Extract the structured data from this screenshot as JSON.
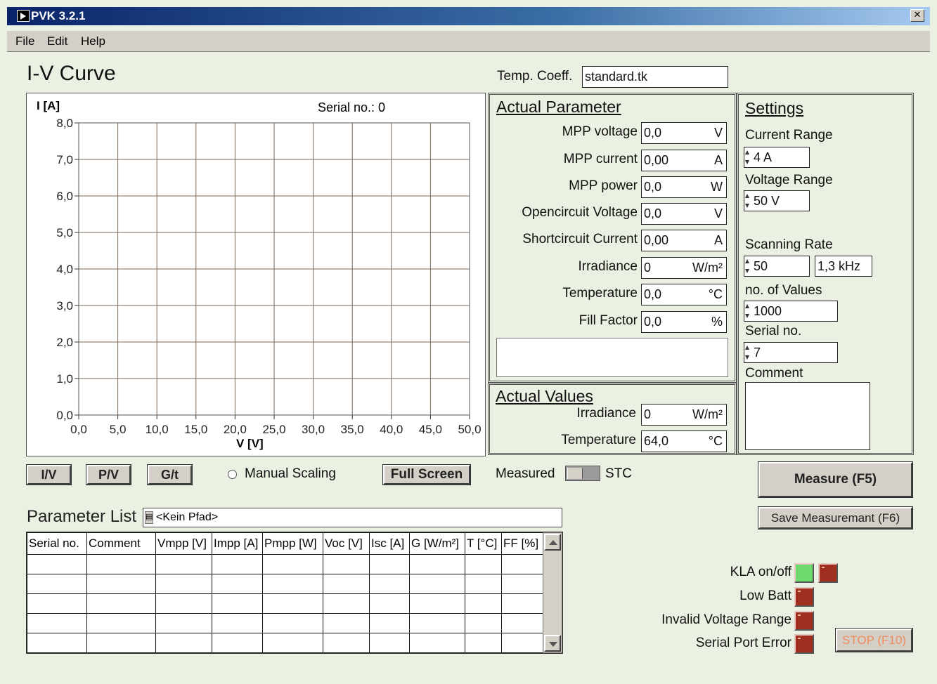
{
  "window": {
    "title": "PVK 3.2.1",
    "close": "✕"
  },
  "menu": [
    "File",
    "Edit",
    "Help"
  ],
  "page_title": "I-V Curve",
  "temp_coeff": {
    "label": "Temp. Coeff.",
    "value": "standard.tk"
  },
  "chart_data": {
    "type": "line",
    "title": "",
    "xlabel": "V [V]",
    "ylabel": "I [A]",
    "annotation": "Serial no.: 0",
    "x_ticks": [
      "0,0",
      "5,0",
      "10,0",
      "15,0",
      "20,0",
      "25,0",
      "30,0",
      "35,0",
      "40,0",
      "45,0",
      "50,0"
    ],
    "y_ticks": [
      "8,0",
      "7,0",
      "6,0",
      "5,0",
      "4,0",
      "3,0",
      "2,0",
      "1,0",
      "0,0"
    ],
    "xlim": [
      0,
      50
    ],
    "ylim": [
      0,
      8
    ],
    "grid": true,
    "series": []
  },
  "actual_parameter": {
    "title": "Actual Parameter",
    "rows": [
      {
        "label": "MPP voltage",
        "value": "0,0",
        "unit": "V"
      },
      {
        "label": "MPP current",
        "value": "0,00",
        "unit": "A"
      },
      {
        "label": "MPP power",
        "value": "0,0",
        "unit": "W"
      },
      {
        "label": "Opencircuit Voltage",
        "value": "0,0",
        "unit": "V"
      },
      {
        "label": "Shortcircuit Current",
        "value": "0,00",
        "unit": "A"
      },
      {
        "label": "Irradiance",
        "value": "0",
        "unit": "W/m²"
      },
      {
        "label": "Temperature",
        "value": "0,0",
        "unit": "°C"
      },
      {
        "label": "Fill Factor",
        "value": "0,0",
        "unit": "%"
      }
    ]
  },
  "actual_values": {
    "title": "Actual Values",
    "rows": [
      {
        "label": "Irradiance",
        "value": "0",
        "unit": "W/m²"
      },
      {
        "label": "Temperature",
        "value": "64,0",
        "unit": "°C"
      }
    ]
  },
  "settings": {
    "title": "Settings",
    "current_range_label": "Current Range",
    "current_range": "4 A",
    "voltage_range_label": "Voltage Range",
    "voltage_range": "50 V",
    "scanning_rate_label": "Scanning Rate",
    "scanning_rate": "50",
    "scanning_freq": "1,3  kHz",
    "num_values_label": "no. of Values",
    "num_values": "1000",
    "serial_label": "Serial no.",
    "serial": "7",
    "comment_label": "Comment"
  },
  "controls": {
    "iv": "I/V",
    "pv": "P/V",
    "gt": "G/t",
    "manual_scaling": "Manual Scaling",
    "full_screen": "Full Screen",
    "measured": "Measured",
    "stc": "STC",
    "measure": "Measure (F5)",
    "save": "Save Measuremant (F6)",
    "stop": "STOP (F10)"
  },
  "param_list": {
    "label": "Parameter List",
    "path_icon": "folder-path-icon",
    "path": "<Kein Pfad>",
    "columns": [
      "Serial no.",
      "Comment",
      "Vmpp [V]",
      "Impp [A]",
      "Pmpp [W]",
      "Voc [V]",
      "Isc [A]",
      "G [W/m²]",
      "T [°C]",
      "FF [%]"
    ]
  },
  "status": {
    "kla": "KLA on/off",
    "low_batt": "Low Batt",
    "invalid_voltage": "Invalid Voltage Range",
    "serial_error": "Serial Port Error"
  },
  "colors": {
    "background": "#eaf0e2",
    "titlebar": "#0a246a",
    "led_red": "#a02f1f",
    "led_green": "#6fda6f",
    "stop_text": "#f08a5a"
  }
}
